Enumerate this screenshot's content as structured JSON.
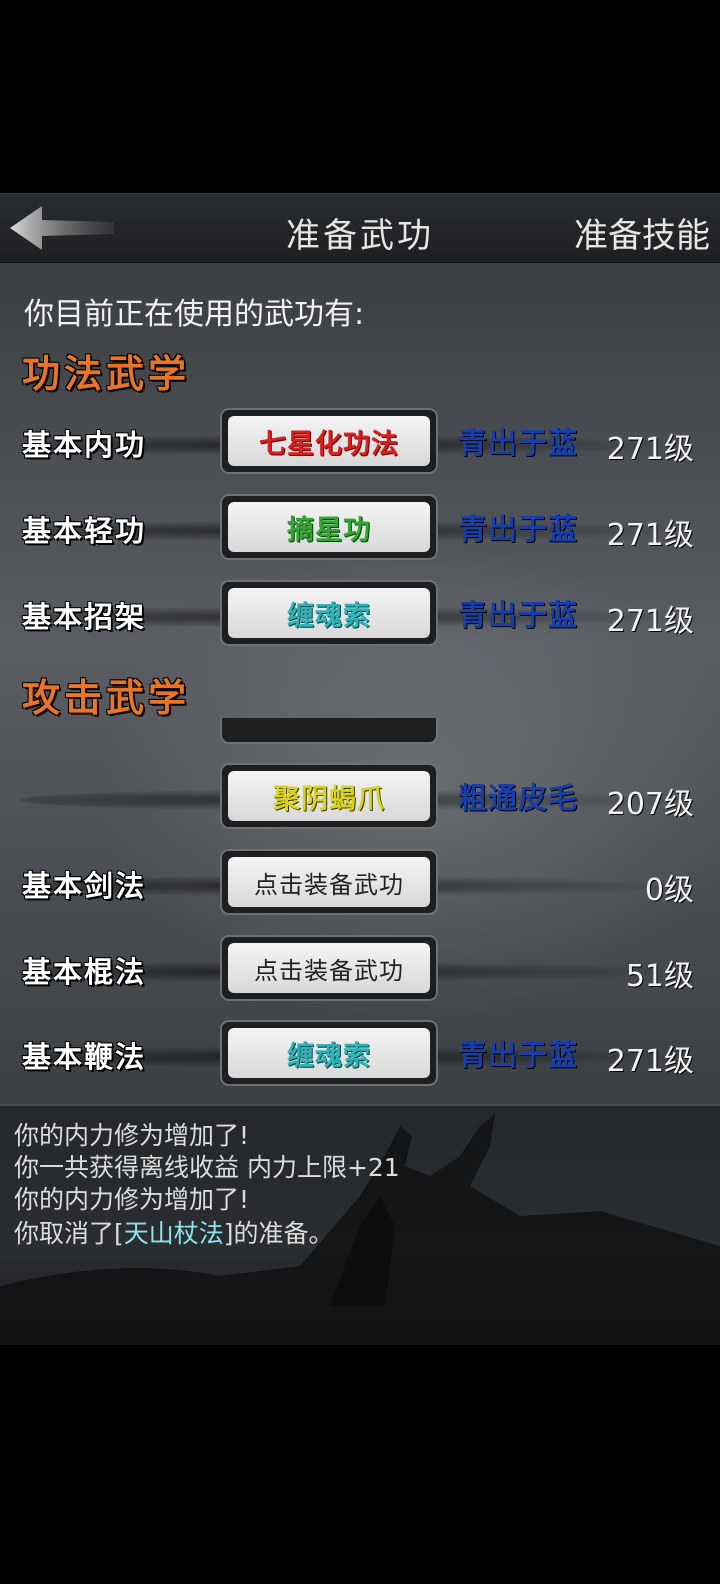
{
  "header": {
    "title": "准备武功",
    "right_link": "准备技能"
  },
  "intro": "你目前正在使用的武功有:",
  "sections": {
    "internal": "功法武学",
    "attack": "攻击武学"
  },
  "rows_top": [
    {
      "label": "基本内功",
      "skill": "七星化功法",
      "skill_color": "#d92020",
      "rank": "青出于蓝",
      "rank_color": "#1a3ea8",
      "level": "271级"
    },
    {
      "label": "基本轻功",
      "skill": "摘星功",
      "skill_color": "#2ea82e",
      "rank": "青出于蓝",
      "rank_color": "#1a3ea8",
      "level": "271级"
    },
    {
      "label": "基本招架",
      "skill": "缠魂索",
      "skill_color": "#2db3b8",
      "rank": "青出于蓝",
      "rank_color": "#1a3ea8",
      "level": "271级"
    }
  ],
  "rows_bottom": [
    {
      "label": "",
      "skill": "聚阴蝎爪",
      "skill_color": "#d8d222",
      "rank": "粗通皮毛",
      "rank_color": "#1a3ea8",
      "level": "207级"
    },
    {
      "label": "基本剑法",
      "skill": "点击装备武功",
      "skill_color": "#222222",
      "rank": "",
      "rank_color": "#1a3ea8",
      "level": "0级"
    },
    {
      "label": "基本棍法",
      "skill": "点击装备武功",
      "skill_color": "#222222",
      "rank": "",
      "rank_color": "#1a3ea8",
      "level": "51级"
    },
    {
      "label": "基本鞭法",
      "skill": "缠魂索",
      "skill_color": "#2db3b8",
      "rank": "青出于蓝",
      "rank_color": "#1a3ea8",
      "level": "271级"
    }
  ],
  "log": {
    "line1": "你的内力修为增加了!",
    "line2": "你一共获得离线收益 内力上限+21",
    "line3": "你的内力修为增加了!",
    "line4_prefix": "你取消了[",
    "line4_skill": "天山杖法",
    "line4_suffix": "]的准备。"
  },
  "icons": {
    "back": "back-arrow-icon"
  }
}
